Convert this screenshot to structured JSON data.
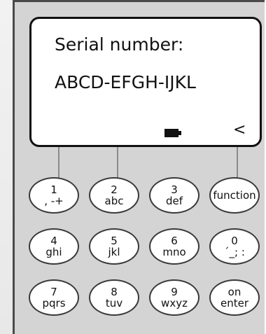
{
  "display": {
    "line1": "Serial number:",
    "line2": "ABCD-EFGH-IJKL",
    "battery_icon": "battery-icon",
    "back_indicator": "<"
  },
  "keypad": {
    "row1": [
      {
        "top": "1",
        "bottom": ", -+"
      },
      {
        "top": "2",
        "bottom": "abc"
      },
      {
        "top": "3",
        "bottom": "def"
      },
      {
        "label": "function"
      }
    ],
    "row2": [
      {
        "top": "4",
        "bottom": "ghi"
      },
      {
        "top": "5",
        "bottom": "jkl"
      },
      {
        "top": "6",
        "bottom": "mno"
      },
      {
        "top": "0",
        "bottom": "´_; :"
      }
    ],
    "row3": [
      {
        "top": "7",
        "bottom": "pqrs"
      },
      {
        "top": "8",
        "bottom": "tuv"
      },
      {
        "top": "9",
        "bottom": "wxyz"
      },
      {
        "top": "on",
        "bottom": "enter"
      }
    ]
  },
  "colors": {
    "body": "#d4d4d4",
    "screen": "#ffffff",
    "outline": "#111111"
  }
}
